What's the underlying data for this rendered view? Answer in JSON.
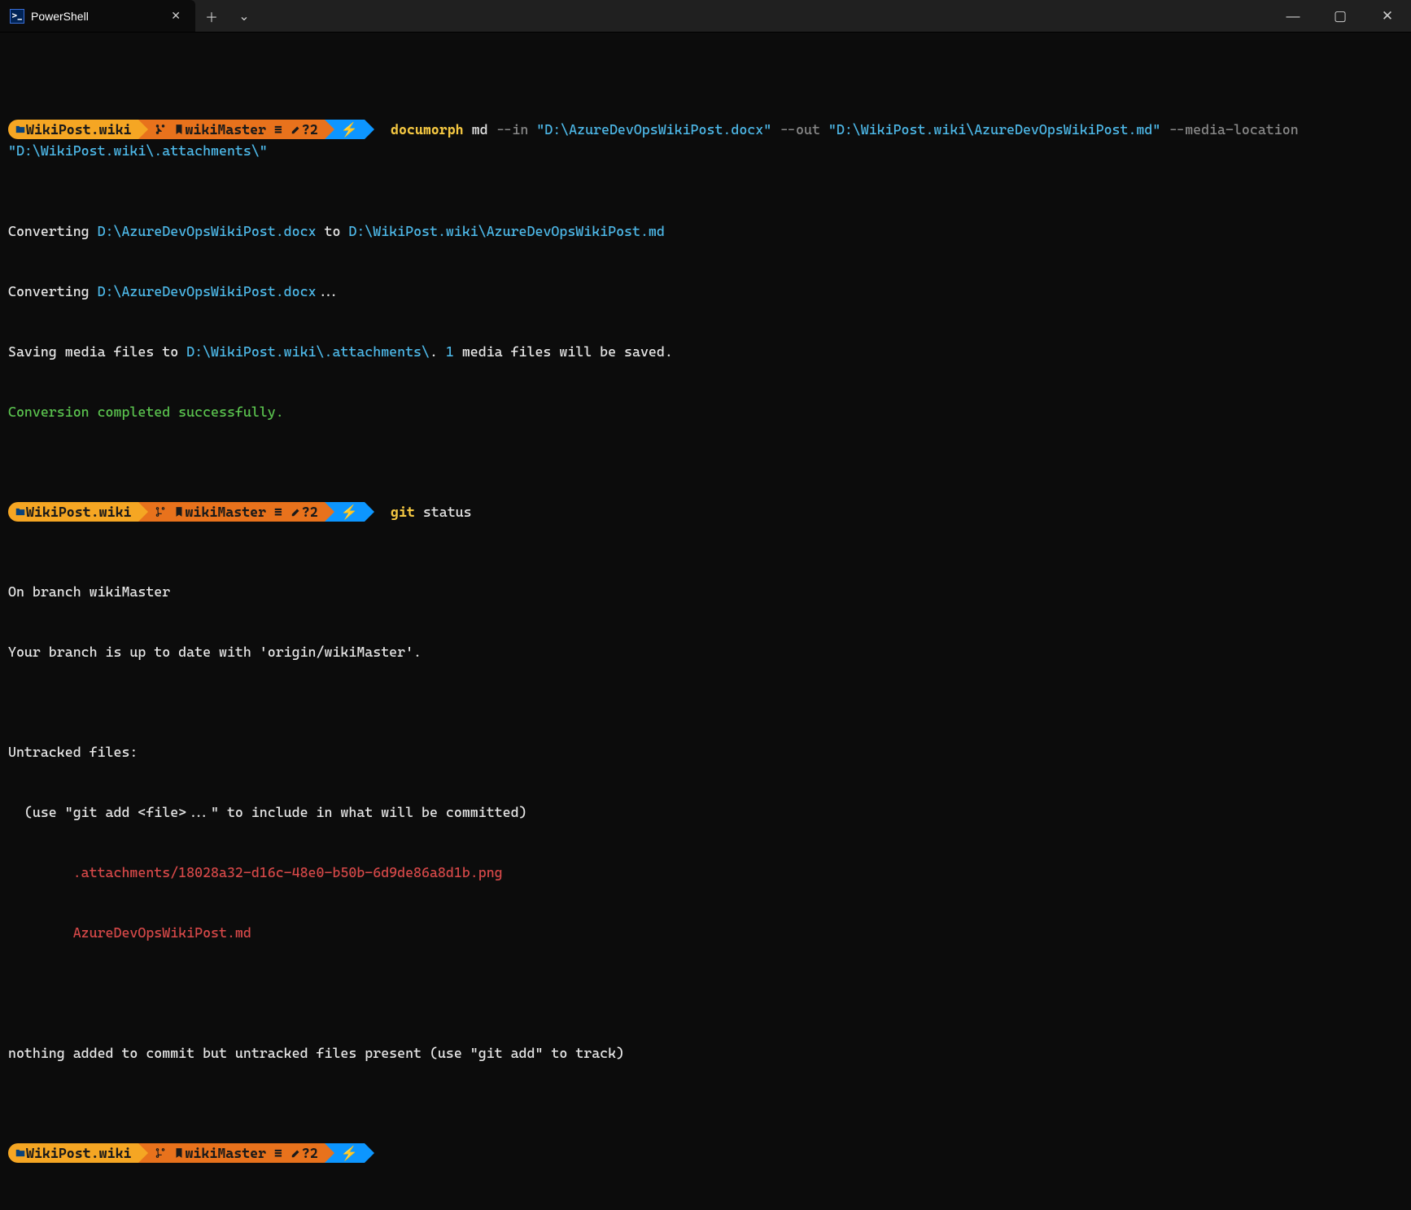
{
  "titlebar": {
    "tab_title": "PowerShell",
    "tab_icon_text": ">_"
  },
  "prompt": {
    "path": "WikiPost.wiki",
    "branch": "wikiMaster",
    "branch_symbols": " ≡ ",
    "branch_pending": "?2",
    "lightning": "⚡"
  },
  "cmd1": {
    "exe": "documorph",
    "sub": " md ",
    "flag_in": "--in ",
    "arg_in": "\"D:\\AzureDevOpsWikiPost.docx\"",
    "flag_out": " --out ",
    "arg_out": "\"D:\\WikiPost.wiki\\AzureDevOpsWikiPost.md\"",
    "flag_media": " --media-location ",
    "arg_media": "\"D:\\WikiPost.wiki\\.attachments\\\""
  },
  "out1": {
    "l1_pre": "Converting ",
    "l1_src": "D:\\AzureDevOpsWikiPost.docx",
    "l1_mid": " to ",
    "l1_dst": "D:\\WikiPost.wiki\\AzureDevOpsWikiPost.md",
    "l2_pre": "Converting ",
    "l2_src": "D:\\AzureDevOpsWikiPost.docx",
    "l2_post": "...",
    "l3_pre": "Saving media files to ",
    "l3_path": "D:\\WikiPost.wiki\\.attachments\\",
    "l3_mid": ". ",
    "l3_count": "1",
    "l3_post": " media files will be saved.",
    "success": "Conversion completed successfully."
  },
  "cmd2": {
    "exe": "git",
    "args": " status"
  },
  "out2": {
    "l1": "On branch wikiMaster",
    "l2": "Your branch is up to date with 'origin/wikiMaster'.",
    "blank": "",
    "l3": "Untracked files:",
    "l4": "  (use \"git add <file>...\" to include in what will be committed)",
    "f1": "        .attachments/18028a32-d16c-48e0-b50b-6d9de86a8d1b.png",
    "f2": "        AzureDevOpsWikiPost.md",
    "l5": "nothing added to commit but untracked files present (use \"git add\" to track)"
  }
}
